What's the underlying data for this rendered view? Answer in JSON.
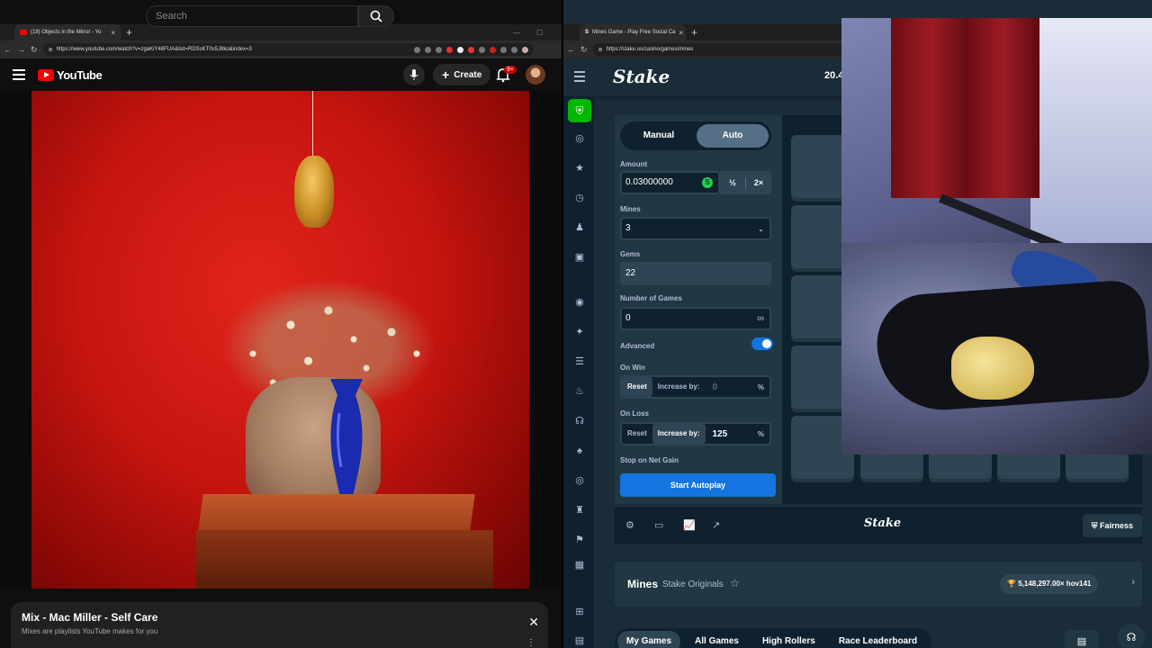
{
  "youtube": {
    "tab": {
      "title": "(18) Objects in the Mirror - Yo",
      "close": "×"
    },
    "new_tab": "+",
    "url": "https://www.youtube.com/watch?v=zgaKiY48FUA&list=RDSsKT0s5J8ko&index=3",
    "logo_text": "YouTube",
    "search_placeholder": "Search",
    "create_label": "Create",
    "notif_count": "9+",
    "mix": {
      "title": "Mix - Mac Miller - Self Care",
      "subtitle": "Mixes are playlists YouTube makes for you",
      "close": "✕",
      "more": "⋮"
    }
  },
  "stake": {
    "tab": {
      "title": "Mines Game - Play Free Social Ca",
      "close": "×"
    },
    "new_tab": "+",
    "url": "https://stake.us/casino/games/mines",
    "logo": "Stake",
    "balance": "20.4",
    "modes": [
      "Manual",
      "Auto"
    ],
    "active_mode": "Auto",
    "amount": {
      "label": "Amount",
      "value": "0.03000000",
      "coin": "S",
      "half": "½",
      "double": "2×"
    },
    "mines": {
      "label": "Mines",
      "value": "3"
    },
    "gems": {
      "label": "Gems",
      "value": "22"
    },
    "num_games": {
      "label": "Number of Games",
      "value": "0",
      "icon": "∞"
    },
    "advanced": {
      "label": "Advanced",
      "enabled": true
    },
    "on_win": {
      "label": "On Win",
      "reset": "Reset",
      "increase": "Increase by:",
      "value": "0",
      "unit": "%",
      "selected": "Reset"
    },
    "on_loss": {
      "label": "On Loss",
      "reset": "Reset",
      "increase": "Increase by:",
      "value": "125",
      "unit": "%",
      "selected": "Increase by:"
    },
    "stop_net_gain": {
      "label": "Stop on Net Gain"
    },
    "start_button": "Start Autoplay",
    "footer_logo": "Stake",
    "fairness": "Fairness",
    "info": {
      "game": "Mines",
      "category": "Stake Originals",
      "record": "5,148,297.00× hov141"
    },
    "game_tabs": [
      "My Games",
      "All Games",
      "High Rollers",
      "Race Leaderboard"
    ],
    "active_game_tab": "My Games"
  },
  "colors": {
    "stake_bg": "#1a2c38",
    "stake_panel": "#213743",
    "stake_dark": "#0f212e",
    "stake_blue": "#1475e1",
    "stake_green": "#00b801",
    "youtube_red": "#ff0000"
  }
}
